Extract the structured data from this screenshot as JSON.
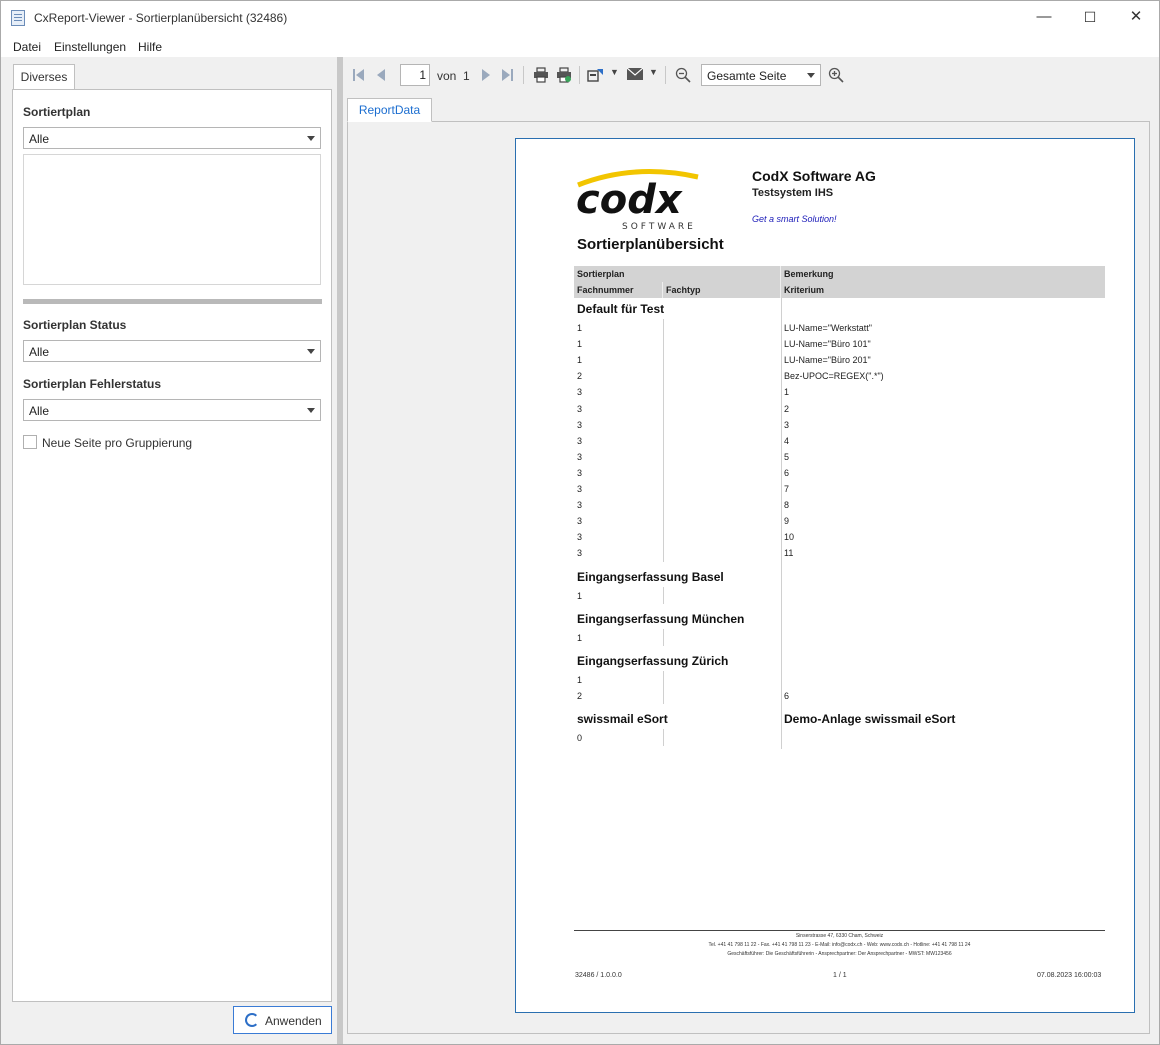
{
  "window": {
    "title": "CxReport-Viewer - Sortierplanübersicht (32486)",
    "buttons": {
      "minimize": "—",
      "maximize": "☐",
      "close": "✕"
    }
  },
  "menu": [
    "Datei",
    "Einstellungen",
    "Hilfe"
  ],
  "left_panel": {
    "tab": "Diverses",
    "sortierplan": {
      "label": "Sortiertplan",
      "value": "Alle"
    },
    "status": {
      "label": "Sortierplan Status",
      "value": "Alle"
    },
    "fehlerstatus": {
      "label": "Sortierplan Fehlerstatus",
      "value": "Alle"
    },
    "checkbox_label": "Neue Seite pro Gruppierung",
    "checkbox_checked": false,
    "apply_label": "Anwenden"
  },
  "toolbar": {
    "page": "1",
    "of_label": "von",
    "total_pages": "1",
    "zoom": "Gesamte Seite"
  },
  "report_tab": "ReportData",
  "report": {
    "company": "CodX Software AG",
    "system": "Testsystem IHS",
    "slogan": "Get a smart Solution!",
    "logo_text": "codx",
    "logo_sub": "SOFTWARE",
    "title": "Sortierplanübersicht",
    "headers": {
      "sortierplan": "Sortierplan",
      "bemerkung": "Bemerkung",
      "fachnummer": "Fachnummer",
      "fachtyp": "Fachtyp",
      "kriterium": "Kriterium"
    },
    "groups": [
      {
        "name": "Default für Test",
        "remark": "",
        "rows": [
          {
            "fach": "1",
            "kriterium": "LU-Name=\"Werkstatt\""
          },
          {
            "fach": "1",
            "kriterium": "LU-Name=\"Büro 101\""
          },
          {
            "fach": "1",
            "kriterium": "LU-Name=\"Büro 201\""
          },
          {
            "fach": "2",
            "kriterium": "Bez-UPOC=REGEX(\".*\")"
          },
          {
            "fach": "3",
            "kriterium": "1"
          },
          {
            "fach": "3",
            "kriterium": "2"
          },
          {
            "fach": "3",
            "kriterium": "3"
          },
          {
            "fach": "3",
            "kriterium": "4"
          },
          {
            "fach": "3",
            "kriterium": "5"
          },
          {
            "fach": "3",
            "kriterium": "6"
          },
          {
            "fach": "3",
            "kriterium": "7"
          },
          {
            "fach": "3",
            "kriterium": "8"
          },
          {
            "fach": "3",
            "kriterium": "9"
          },
          {
            "fach": "3",
            "kriterium": "10"
          },
          {
            "fach": "3",
            "kriterium": "11"
          }
        ]
      },
      {
        "name": "Eingangserfassung Basel",
        "remark": "",
        "rows": [
          {
            "fach": "1",
            "kriterium": ""
          }
        ]
      },
      {
        "name": "Eingangserfassung München",
        "remark": "",
        "rows": [
          {
            "fach": "1",
            "kriterium": ""
          }
        ]
      },
      {
        "name": "Eingangserfassung Zürich",
        "remark": "",
        "rows": [
          {
            "fach": "1",
            "kriterium": ""
          },
          {
            "fach": "2",
            "kriterium": "6"
          }
        ]
      },
      {
        "name": "swissmail eSort",
        "remark": "Demo-Anlage swissmail eSort",
        "rows": [
          {
            "fach": "0",
            "kriterium": ""
          }
        ]
      }
    ],
    "footer": {
      "line1": "Sinserstrasse 47, 6330 Cham, Schweiz",
      "line2": "Tel. +41 41 798 11 22 - Fax. +41 41 798 11 23 - E-Mail: info@codx.ch - Web: www.codx.ch - Hotline: +41 41 798 11 24",
      "line3": "Geschäftsführer: Die Geschäftsführerin - Ansprechpartner: Der Ansprechpartner - MWST: MW123456",
      "left": "32486 / 1.0.0.0",
      "center": "1 / 1",
      "right": "07.08.2023 16:00:03"
    }
  }
}
